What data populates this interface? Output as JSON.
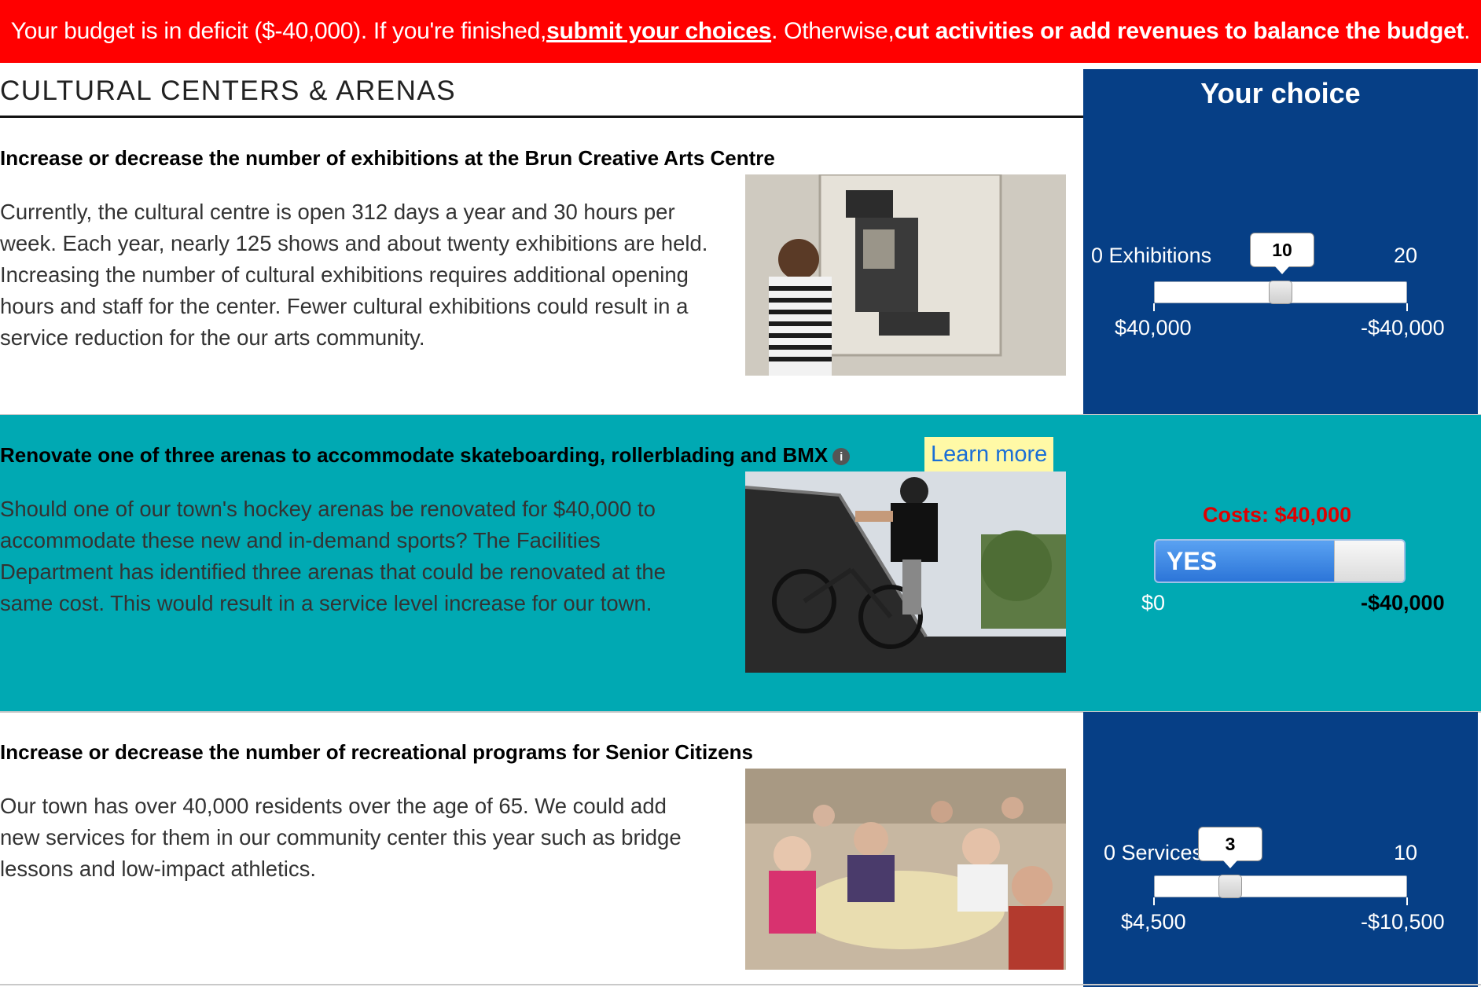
{
  "banner": {
    "prefix": "Your budget is in deficit ($-40,000). If you're finished, ",
    "submit_link": "submit your choices",
    "middle": ". Otherwise, ",
    "action": "cut activities or add revenues to balance the budget",
    "suffix": "."
  },
  "section": {
    "title": "CULTURAL CENTERS & ARENAS",
    "choice_header": "Your choice"
  },
  "items": [
    {
      "title": "Increase or decrease the number of exhibitions at the Brun Creative Arts Centre",
      "description": "Currently, the cultural centre is open 312 days a year and 30 hours per week. Each year, nearly 125 shows and about twenty exhibitions are held. Increasing the number of cultural exhibitions requires additional opening hours and staff for the center. Fewer cultural exhibitions could result in a service reduction for the our arts community.",
      "control": {
        "type": "slider",
        "min_label": "0 Exhibitions",
        "max_label": "20",
        "value": "10",
        "value_fraction": 0.5,
        "left_amount": "$40,000",
        "right_amount": "-$40,000"
      }
    },
    {
      "title": "Renovate one of three arenas to accommodate skateboarding, rollerblading and BMX",
      "learn_more": "Learn more",
      "description": "Should one of our town's hockey arenas be renovated for $40,000 to accommodate these new and in-demand sports? The Facilities Department has identified three arenas that could be renovated at the same cost. This would result in a service level increase for our town.",
      "control": {
        "type": "toggle",
        "costs": "Costs: $40,000",
        "state": "YES",
        "left_amount": "$0",
        "right_amount": "-$40,000"
      }
    },
    {
      "title": "Increase or decrease the number of recreational programs for Senior Citizens",
      "description": "Our town has over 40,000 residents over the age of 65. We could add new services for them in our community center this year such as bridge lessons and low-impact athletics.",
      "control": {
        "type": "slider",
        "min_label": "0 Services",
        "max_label": "10",
        "value": "3",
        "value_fraction": 0.3,
        "left_amount": "$4,500",
        "right_amount": "-$10,500"
      }
    }
  ],
  "colors": {
    "banner": "#ff0000",
    "panel": "#063f86",
    "highlight_row": "#00a9b3",
    "costs": "#e00000"
  }
}
